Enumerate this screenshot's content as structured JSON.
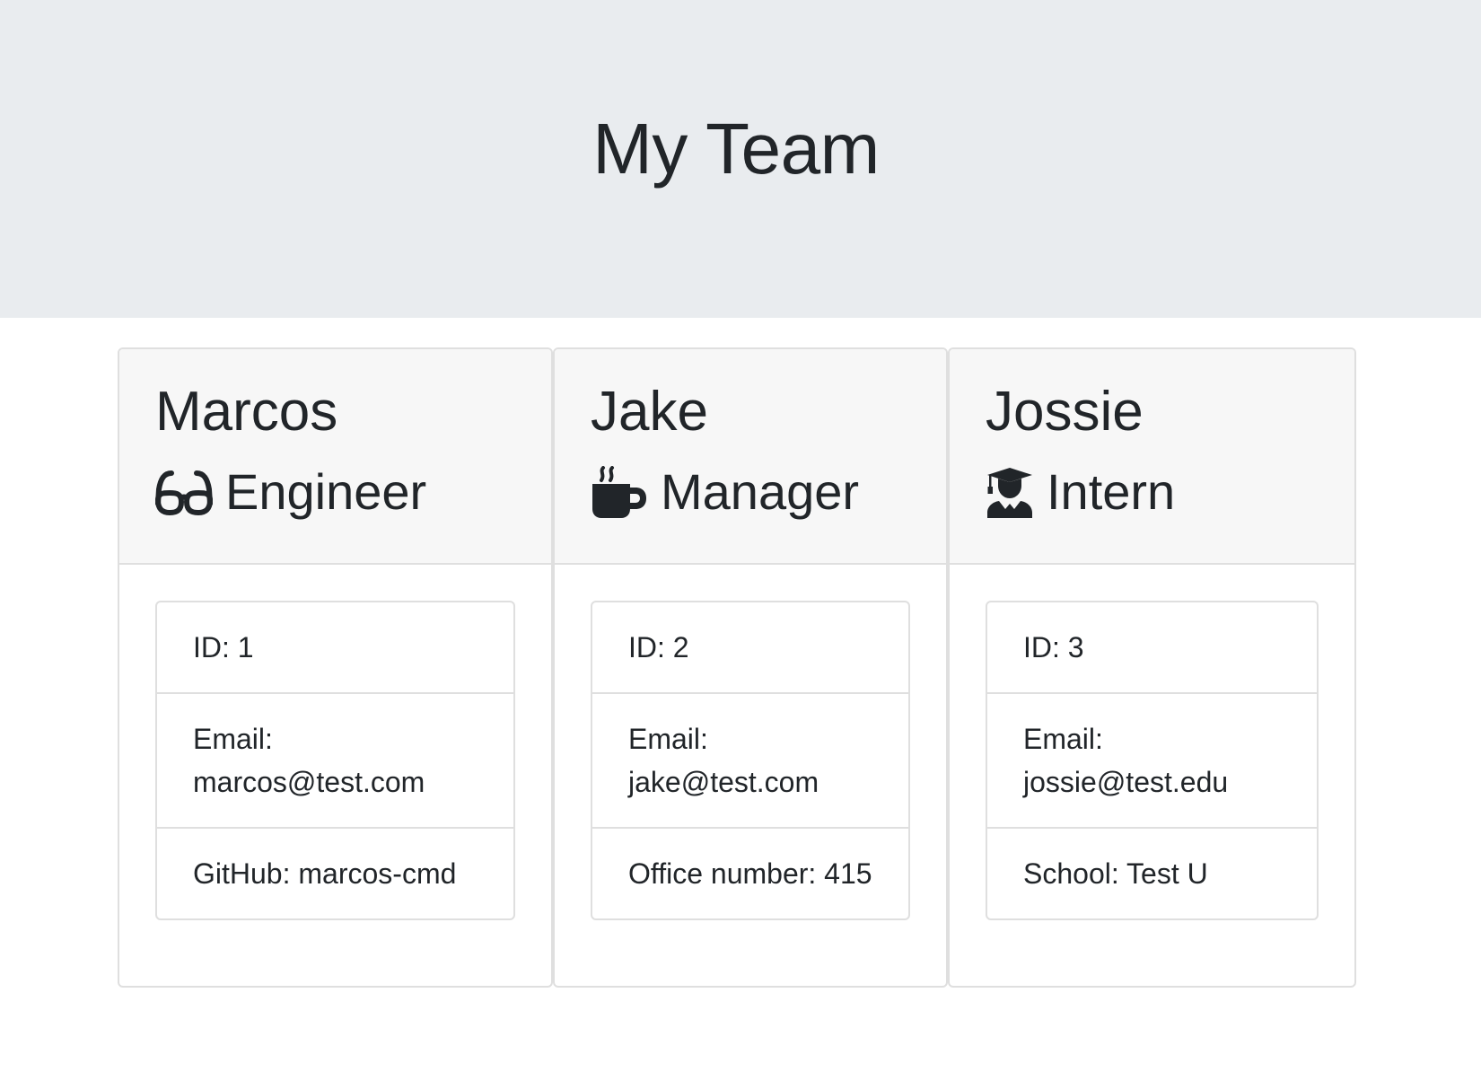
{
  "header": {
    "title": "My Team"
  },
  "team": [
    {
      "name": "Marcos",
      "role": "Engineer",
      "icon": "glasses-icon",
      "details": [
        "ID: 1",
        "Email: marcos@test.com",
        "GitHub: marcos-cmd"
      ]
    },
    {
      "name": "Jake",
      "role": "Manager",
      "icon": "coffee-icon",
      "details": [
        "ID: 2",
        "Email: jake@test.com",
        "Office number: 415"
      ]
    },
    {
      "name": "Jossie",
      "role": "Intern",
      "icon": "graduate-icon",
      "details": [
        "ID: 3",
        "Email: jossie@test.edu",
        "School: Test U"
      ]
    }
  ]
}
